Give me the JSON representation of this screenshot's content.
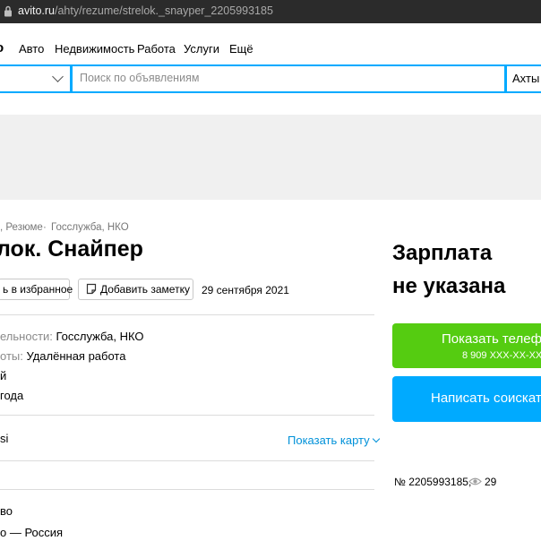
{
  "browser": {
    "url_domain": "avito.ru",
    "url_path": "/ahty/rezume/strelok._snayper_2205993185"
  },
  "header": {
    "logo_fragment": "o",
    "nav": [
      "Авто",
      "Недвижимость",
      "Работа",
      "Услуги",
      "Ещё"
    ]
  },
  "search": {
    "placeholder": "Поиск по объявлениям",
    "location": "Ахты"
  },
  "breadcrumb": [
    ", Резюме",
    "Госслужба, НКО"
  ],
  "title": "лок. Снайпер",
  "actions": {
    "favorite_label": "ь в избранное",
    "note_label": "Добавить заметку",
    "date": "29 сентября 2021"
  },
  "details": [
    {
      "key": "ельности: ",
      "value": "Госслужба, НКО"
    },
    {
      "key": "оты: ",
      "value": "Удалённая работа"
    },
    {
      "key": "",
      "value": "й"
    },
    {
      "key": "",
      "value": "года"
    }
  ],
  "location_section": {
    "text": "si",
    "map_link": "Показать карту"
  },
  "lower_rows": [
    "во",
    "о — Россия"
  ],
  "sidebar": {
    "salary_line1": "Зарплата",
    "salary_line2": "не указана",
    "show_phone_label": "Показать телеф",
    "phone_masked": "8 909 XXX-XX-XX",
    "write_label": "Написать соискат",
    "ad_number": "№ 2205993185,",
    "views": "29"
  },
  "colors": {
    "accent_blue": "#00aaff",
    "link_blue": "#0091d9",
    "green": "#55cc11"
  }
}
